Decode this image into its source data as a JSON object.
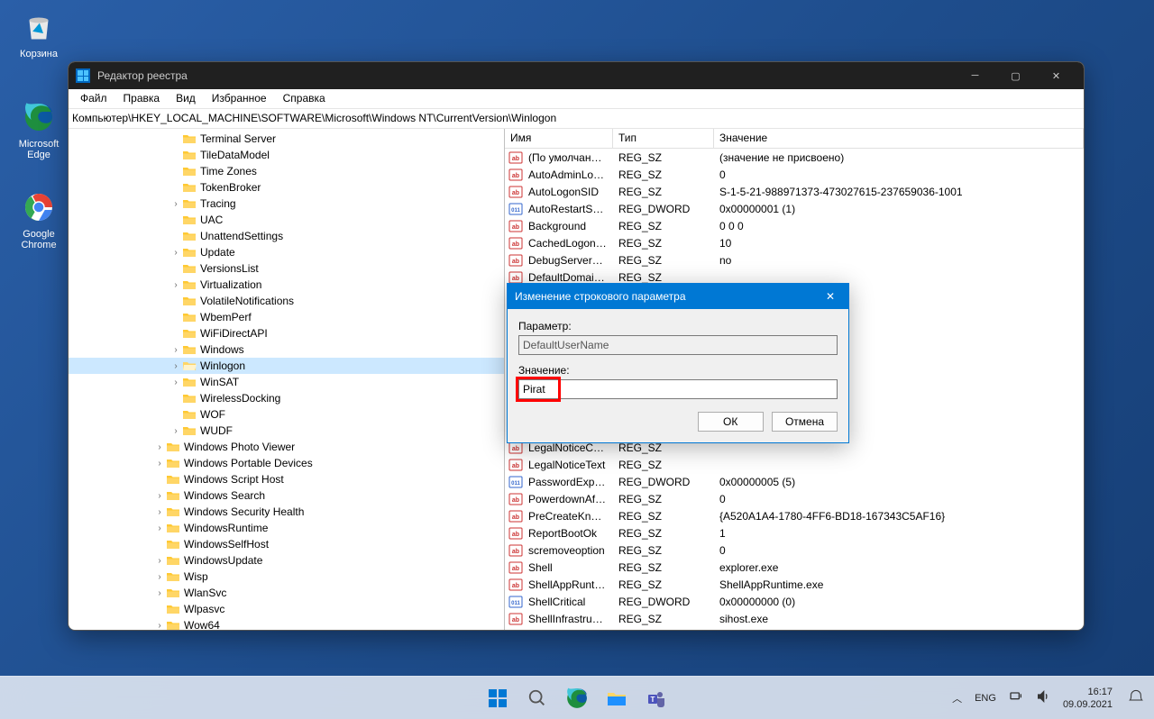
{
  "desktop": {
    "recycle_bin": "Корзина",
    "edge": "Microsoft Edge",
    "chrome": "Google Chrome"
  },
  "window": {
    "title": "Редактор реестра",
    "menu": [
      "Файл",
      "Правка",
      "Вид",
      "Избранное",
      "Справка"
    ],
    "path": "Компьютер\\HKEY_LOCAL_MACHINE\\SOFTWARE\\Microsoft\\Windows NT\\CurrentVersion\\Winlogon"
  },
  "tree": [
    {
      "indent": 6,
      "chev": "",
      "label": "Terminal Server"
    },
    {
      "indent": 6,
      "chev": "",
      "label": "TileDataModel"
    },
    {
      "indent": 6,
      "chev": "",
      "label": "Time Zones"
    },
    {
      "indent": 6,
      "chev": "",
      "label": "TokenBroker"
    },
    {
      "indent": 6,
      "chev": ">",
      "label": "Tracing"
    },
    {
      "indent": 6,
      "chev": "",
      "label": "UAC"
    },
    {
      "indent": 6,
      "chev": "",
      "label": "UnattendSettings"
    },
    {
      "indent": 6,
      "chev": ">",
      "label": "Update"
    },
    {
      "indent": 6,
      "chev": "",
      "label": "VersionsList"
    },
    {
      "indent": 6,
      "chev": ">",
      "label": "Virtualization"
    },
    {
      "indent": 6,
      "chev": "",
      "label": "VolatileNotifications"
    },
    {
      "indent": 6,
      "chev": "",
      "label": "WbemPerf"
    },
    {
      "indent": 6,
      "chev": "",
      "label": "WiFiDirectAPI"
    },
    {
      "indent": 6,
      "chev": ">",
      "label": "Windows"
    },
    {
      "indent": 6,
      "chev": ">",
      "label": "Winlogon",
      "selected": true,
      "open": true
    },
    {
      "indent": 6,
      "chev": ">",
      "label": "WinSAT"
    },
    {
      "indent": 6,
      "chev": "",
      "label": "WirelessDocking"
    },
    {
      "indent": 6,
      "chev": "",
      "label": "WOF"
    },
    {
      "indent": 6,
      "chev": ">",
      "label": "WUDF"
    },
    {
      "indent": 5,
      "chev": ">",
      "label": "Windows Photo Viewer"
    },
    {
      "indent": 5,
      "chev": ">",
      "label": "Windows Portable Devices"
    },
    {
      "indent": 5,
      "chev": "",
      "label": "Windows Script Host"
    },
    {
      "indent": 5,
      "chev": ">",
      "label": "Windows Search"
    },
    {
      "indent": 5,
      "chev": ">",
      "label": "Windows Security Health"
    },
    {
      "indent": 5,
      "chev": ">",
      "label": "WindowsRuntime"
    },
    {
      "indent": 5,
      "chev": "",
      "label": "WindowsSelfHost"
    },
    {
      "indent": 5,
      "chev": ">",
      "label": "WindowsUpdate"
    },
    {
      "indent": 5,
      "chev": ">",
      "label": "Wisp"
    },
    {
      "indent": 5,
      "chev": ">",
      "label": "WlanSvc"
    },
    {
      "indent": 5,
      "chev": "",
      "label": "Wlpasvc"
    },
    {
      "indent": 5,
      "chev": ">",
      "label": "Wow64"
    }
  ],
  "columns": {
    "name": "Имя",
    "type": "Тип",
    "value": "Значение"
  },
  "rows": [
    {
      "ico": "str",
      "name": "(По умолчанию)",
      "type": "REG_SZ",
      "value": "(значение не присвоено)"
    },
    {
      "ico": "str",
      "name": "AutoAdminLogon",
      "type": "REG_SZ",
      "value": "0"
    },
    {
      "ico": "str",
      "name": "AutoLogonSID",
      "type": "REG_SZ",
      "value": "S-1-5-21-988971373-473027615-237659036-1001"
    },
    {
      "ico": "bin",
      "name": "AutoRestartShell",
      "type": "REG_DWORD",
      "value": "0x00000001 (1)"
    },
    {
      "ico": "str",
      "name": "Background",
      "type": "REG_SZ",
      "value": "0 0 0"
    },
    {
      "ico": "str",
      "name": "CachedLogonsC...",
      "type": "REG_SZ",
      "value": "10"
    },
    {
      "ico": "str",
      "name": "DebugServerCo...",
      "type": "REG_SZ",
      "value": "no"
    },
    {
      "ico": "str",
      "name": "DefaultDomain...",
      "type": "REG_SZ",
      "value": ""
    },
    {
      "ico": "str",
      "name": "LegalNoticeCap...",
      "type": "REG_SZ",
      "value": ""
    },
    {
      "ico": "str",
      "name": "LegalNoticeText",
      "type": "REG_SZ",
      "value": ""
    },
    {
      "ico": "bin",
      "name": "PasswordExpiry...",
      "type": "REG_DWORD",
      "value": "0x00000005 (5)"
    },
    {
      "ico": "str",
      "name": "PowerdownAfte...",
      "type": "REG_SZ",
      "value": "0"
    },
    {
      "ico": "str",
      "name": "PreCreateKnow...",
      "type": "REG_SZ",
      "value": "{A520A1A4-1780-4FF6-BD18-167343C5AF16}"
    },
    {
      "ico": "str",
      "name": "ReportBootOk",
      "type": "REG_SZ",
      "value": "1"
    },
    {
      "ico": "str",
      "name": "scremoveoption",
      "type": "REG_SZ",
      "value": "0"
    },
    {
      "ico": "str",
      "name": "Shell",
      "type": "REG_SZ",
      "value": "explorer.exe"
    },
    {
      "ico": "str",
      "name": "ShellAppRuntime",
      "type": "REG_SZ",
      "value": "ShellAppRuntime.exe"
    },
    {
      "ico": "bin",
      "name": "ShellCritical",
      "type": "REG_DWORD",
      "value": "0x00000000 (0)"
    },
    {
      "ico": "str",
      "name": "ShellInfrastructure",
      "type": "REG_SZ",
      "value": "sihost.exe"
    }
  ],
  "dialog": {
    "title": "Изменение строкового параметра",
    "param_label": "Параметр:",
    "param_value": "DefaultUserName",
    "value_label": "Значение:",
    "value_value": "Pirat",
    "ok": "ОК",
    "cancel": "Отмена"
  },
  "taskbar": {
    "lang": "ENG",
    "time": "16:17",
    "date": "09.09.2021"
  }
}
